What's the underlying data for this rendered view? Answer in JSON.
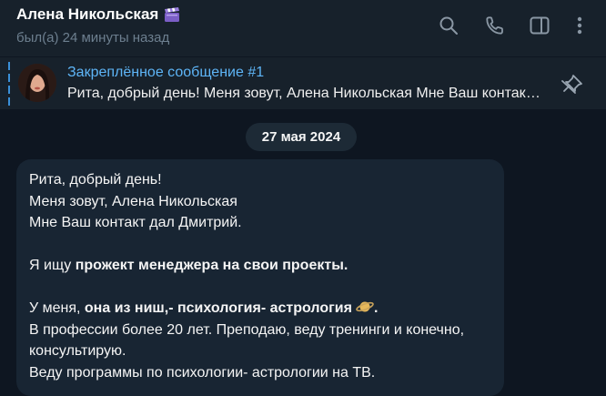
{
  "header": {
    "title": "Алена Никольская",
    "status": "был(а) 24 минуты назад",
    "icons": [
      "search-icon",
      "phone-icon",
      "sidebar-toggle-icon",
      "more-vert-icon"
    ]
  },
  "pinned": {
    "title": "Закреплённое сообщение #1",
    "text": "Рита, добрый день! Меня зовут, Алена Никольская Мне Ваш контакт дал Дмитрий."
  },
  "date_divider": "27 мая 2024",
  "message": {
    "line1": "Рита, добрый день!",
    "line2": "Меня зовут, Алена Никольская",
    "line3": "Мне Ваш контакт дал Дмитрий.",
    "line4_prefix": "Я ищу ",
    "line4_bold": "прожект менеджера на свои проекты.",
    "line5_prefix": "У меня, ",
    "line5_bold": "она из ниш,- психология- астрология",
    "line5_suffix": ".",
    "line6": "В профессии более 20 лет. Преподаю, веду тренинги и конечно, консультирую.",
    "line7": "Веду программы по психологии- астрологии на ТВ."
  },
  "colors": {
    "background": "#0e1621",
    "header": "#17212b",
    "bubble": "#182533",
    "accent": "#5eb5f7",
    "muted": "#6d7f8f"
  }
}
